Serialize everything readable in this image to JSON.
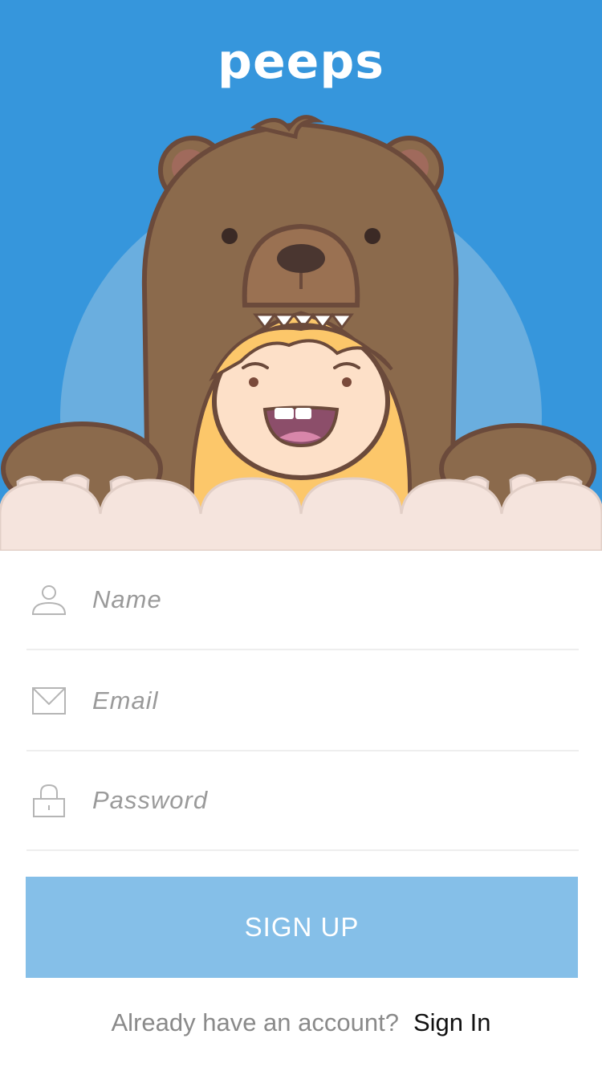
{
  "app": {
    "brand": "peeps"
  },
  "form": {
    "name_placeholder": "Name",
    "email_placeholder": "Email",
    "password_placeholder": "Password",
    "submit_label": "SIGN UP"
  },
  "footer": {
    "prompt": "Already have an account?",
    "link_label": "Sign In"
  },
  "colors": {
    "hero_background": "#3696dc",
    "button_background": "#85bfe8",
    "bear_brown": "#8b6a4c",
    "outline": "#6b4a3b"
  },
  "icons": {
    "name": "user-icon",
    "email": "envelope-icon",
    "password": "lock-icon"
  }
}
